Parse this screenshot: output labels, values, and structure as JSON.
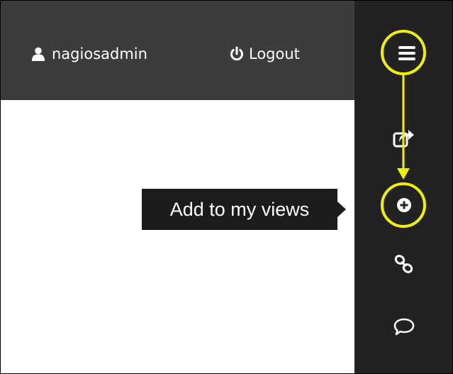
{
  "header": {
    "username": "nagiosadmin",
    "logout_label": "Logout"
  },
  "sidebar": {
    "items": [
      {
        "icon": "menu-icon"
      },
      {
        "icon": "share-icon"
      },
      {
        "icon": "plus-circle-icon"
      },
      {
        "icon": "link-icon"
      },
      {
        "icon": "comment-icon"
      }
    ]
  },
  "tooltip": {
    "text": "Add to my views"
  },
  "colors": {
    "topbar": "#3c3c3c",
    "sidebar": "#222222",
    "tooltip": "#1c1c1c",
    "highlight": "#f0f000",
    "icon": "#ffffff"
  }
}
